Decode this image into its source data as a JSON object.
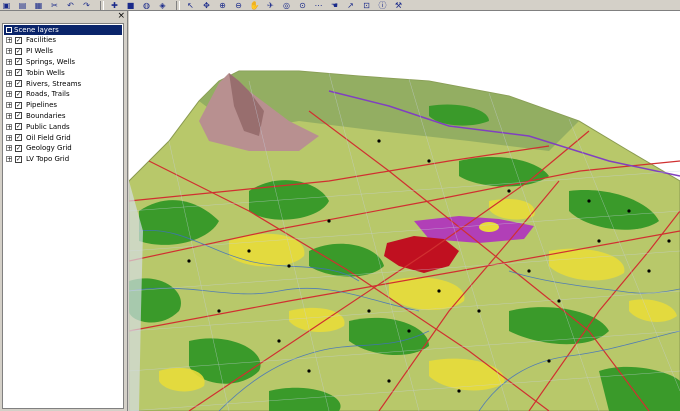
{
  "toolbar": {
    "buttons": [
      "open-icon",
      "save-icon",
      "print-icon",
      "cut-icon",
      "undo-icon",
      "redo-icon",
      "add-data-icon",
      "black-square-icon",
      "globe-icon",
      "layers-icon",
      "select-icon",
      "navigate-icon",
      "zoom-in-icon",
      "zoom-out-icon",
      "pan-icon",
      "fly-icon",
      "target-icon",
      "zoom-to-icon",
      "measure-icon",
      "hand-icon",
      "identify-icon",
      "full-extent-icon",
      "info-icon",
      "tool-icon"
    ],
    "glyphs": [
      "▣",
      "▤",
      "▦",
      "✂",
      "↶",
      "↷",
      "✚",
      "■",
      "◍",
      "◈",
      "↖",
      "✥",
      "⊕",
      "⊖",
      "✋",
      "✈",
      "◎",
      "⊙",
      "⋯",
      "☚",
      "↗",
      "⊡",
      "ⓘ",
      "⚒"
    ],
    "colors": {
      "bg": "#d4d0c8"
    }
  },
  "panel": {
    "close_glyph": "×",
    "root_label": "Scene layers",
    "layers": [
      {
        "label": "Facilities",
        "checked": true
      },
      {
        "label": "PI Wells",
        "checked": true
      },
      {
        "label": "Springs, Wells",
        "checked": true
      },
      {
        "label": "Tobin Wells",
        "checked": true
      },
      {
        "label": "Rivers, Streams",
        "checked": true
      },
      {
        "label": "Roads, Trails",
        "checked": true
      },
      {
        "label": "Pipelines",
        "checked": true
      },
      {
        "label": "Boundaries",
        "checked": true
      },
      {
        "label": "Public Lands",
        "checked": true
      },
      {
        "label": "Oil Field Grid",
        "checked": true
      },
      {
        "label": "Geology Grid",
        "checked": true
      },
      {
        "label": "LV Topo Grid",
        "checked": true
      }
    ],
    "expander_glyph": "+",
    "check_glyph": "✓"
  },
  "scene": {
    "description_colors": {
      "terrain": "#b8c86a",
      "vegetation": "#3a9a2a",
      "sand": "#e8dc3a",
      "mountain": "#b89090",
      "oilfield": "#c01020",
      "public_land": "#b030c0",
      "roads": "#d03030",
      "streams": "#4070c0",
      "grid": "#c0c8d8"
    }
  }
}
